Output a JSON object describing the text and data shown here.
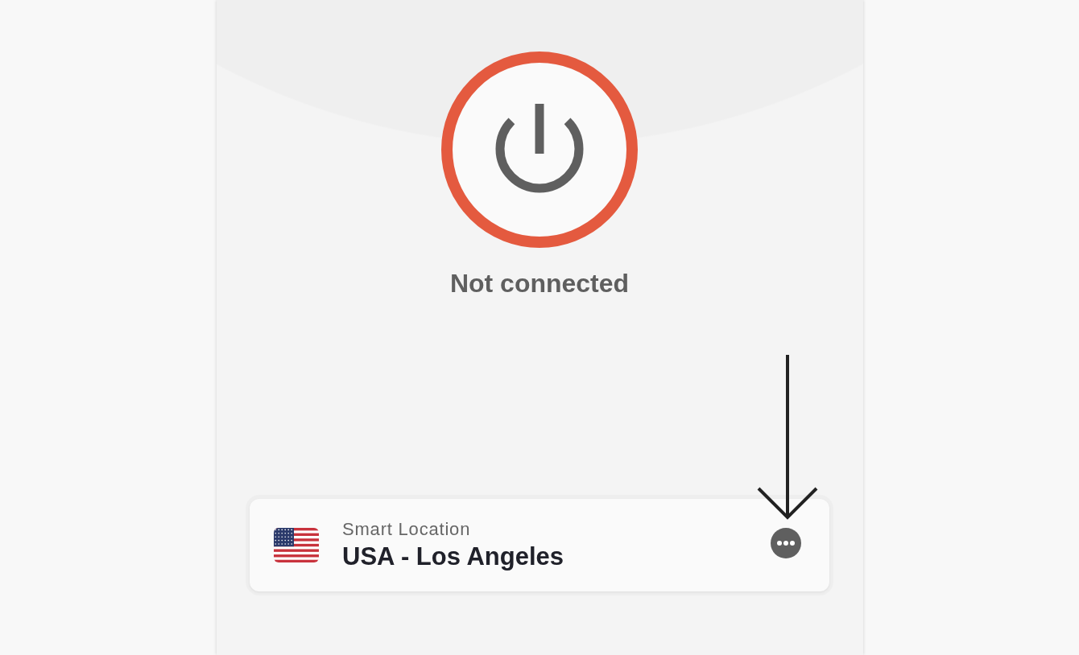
{
  "power_button": {
    "connected": false
  },
  "status": "Not connected",
  "location_card": {
    "label": "Smart Location",
    "location": "USA - Los Angeles"
  }
}
